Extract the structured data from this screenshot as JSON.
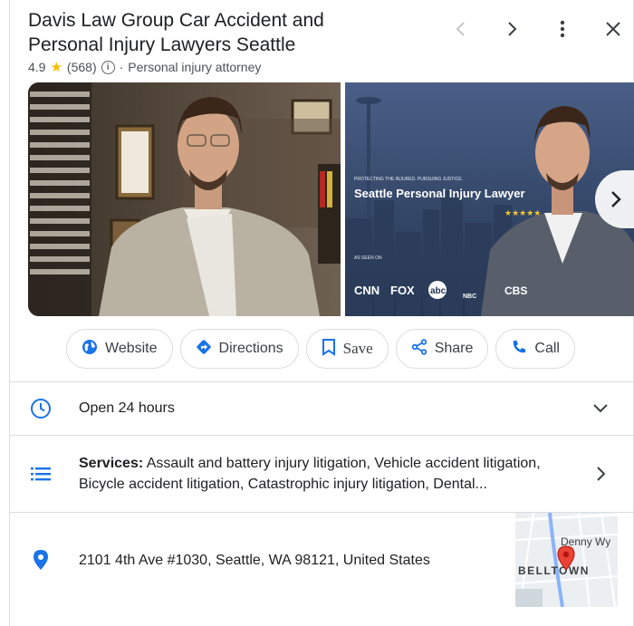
{
  "business": {
    "name": "Davis Law Group Car Accident and Personal Injury Lawyers Seattle",
    "rating": "4.9",
    "review_count": "(568)",
    "separator": "·",
    "category": "Personal injury attorney"
  },
  "header_icons": [
    "chevron-left-icon",
    "chevron-right-icon",
    "more-vert-icon",
    "close-icon"
  ],
  "photo2": {
    "kicker": "PROTECTING THE INJURED. PURSUING JUSTICE.",
    "headline": "Seattle Personal Injury Lawyer",
    "stars": "★★★★★",
    "seen_on": "AS SEEN ON",
    "logos": [
      "CNN",
      "FOX",
      "abc",
      "NBC",
      "CBS"
    ]
  },
  "actions": {
    "website": "Website",
    "directions": "Directions",
    "save": "Save",
    "share": "Share",
    "call": "Call"
  },
  "hours": {
    "status": "Open 24 hours"
  },
  "services": {
    "label": "Services:",
    "text": "Assault and battery injury litigation, Vehicle accident litigation, Bicycle accident litigation, Catastrophic injury litigation, Dental..."
  },
  "address": {
    "text": "2101 4th Ave #1030, Seattle, WA 98121, United States"
  },
  "map": {
    "street": "Denny Wy",
    "neighborhood": "BELLTOWN"
  },
  "colors": {
    "accent_blue": "#1a73e8",
    "open_green": "#188038",
    "star_yellow": "#fbbc04",
    "map_pin_red": "#ea4335"
  }
}
